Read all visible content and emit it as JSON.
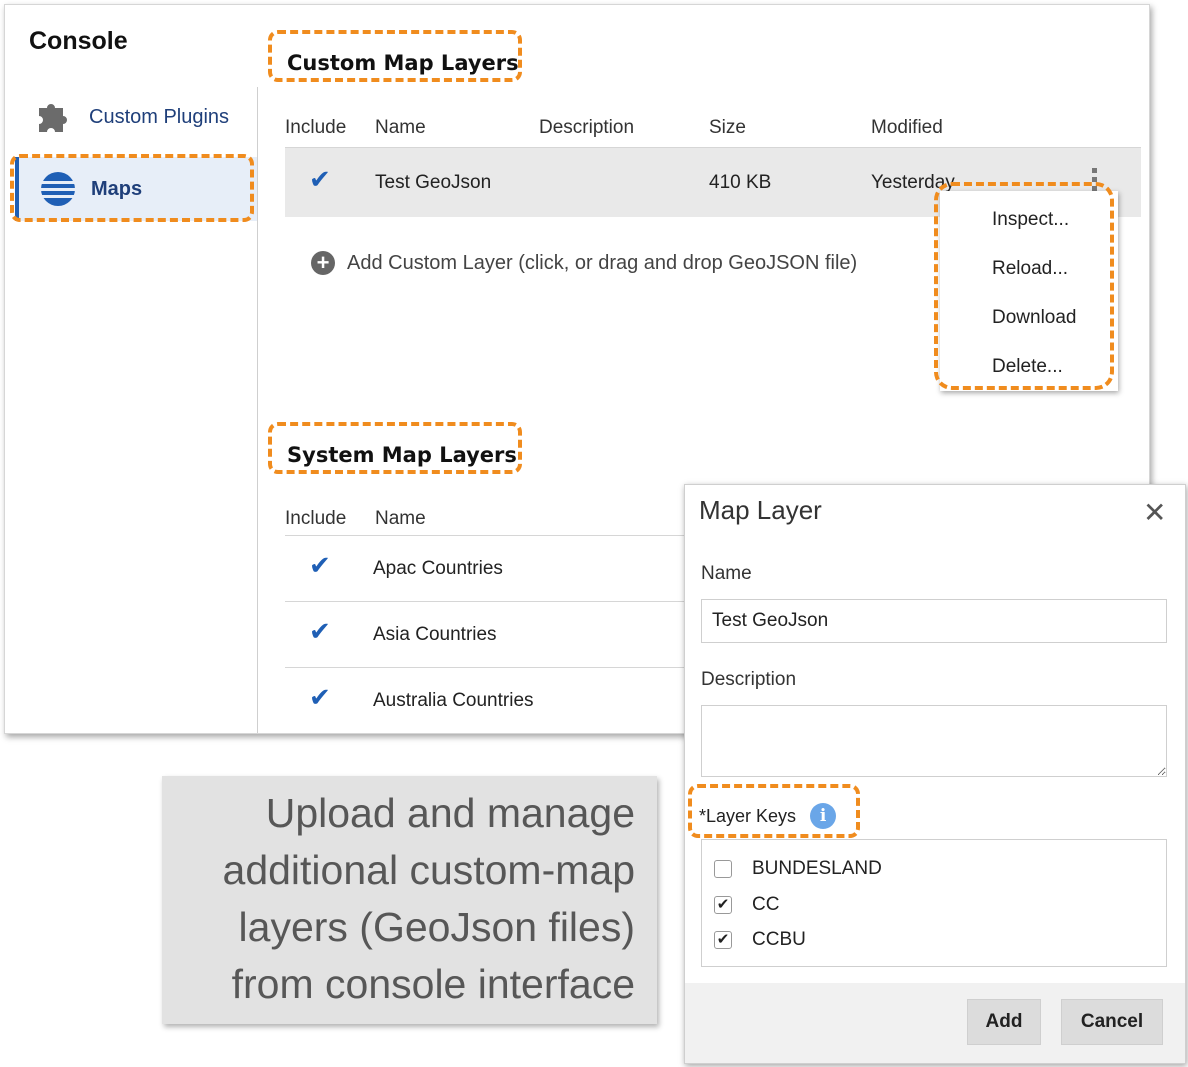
{
  "console": {
    "title": "Console",
    "nav": [
      {
        "label": "Custom Plugins",
        "icon": "puzzle-icon",
        "selected": false
      },
      {
        "label": "Maps",
        "icon": "globe-icon",
        "selected": true
      }
    ]
  },
  "custom_layers": {
    "title": "Custom Map Layers",
    "columns": [
      "Include",
      "Name",
      "Description",
      "Size",
      "Modified"
    ],
    "rows": [
      {
        "name": "Test GeoJson",
        "description": "",
        "size": "410 KB",
        "modified": "Yesterday"
      }
    ],
    "add_label": "Add Custom Layer (click, or drag and drop GeoJSON file)",
    "menu": [
      "Inspect...",
      "Reload...",
      "Download",
      "Delete..."
    ]
  },
  "system_layers": {
    "title": "System Map Layers",
    "columns": [
      "Include",
      "Name"
    ],
    "rows": [
      {
        "name": "Apac Countries"
      },
      {
        "name": "Asia Countries"
      },
      {
        "name": "Australia Countries"
      }
    ]
  },
  "caption": {
    "lines": [
      "Upload and manage",
      "additional custom-map",
      "layers (GeoJson files)",
      "from console interface"
    ]
  },
  "dialog": {
    "title": "Map Layer",
    "name_label": "Name",
    "name_value": "Test GeoJson",
    "description_label": "Description",
    "description_value": "",
    "keys_label": "*Layer Keys",
    "keys": [
      {
        "label": "BUNDESLAND",
        "checked": false
      },
      {
        "label": "CC",
        "checked": true
      },
      {
        "label": "CCBU",
        "checked": true
      }
    ],
    "add_label": "Add",
    "cancel_label": "Cancel"
  },
  "colors": {
    "highlight": "#f08c1e",
    "accent": "#1f5fb5"
  }
}
